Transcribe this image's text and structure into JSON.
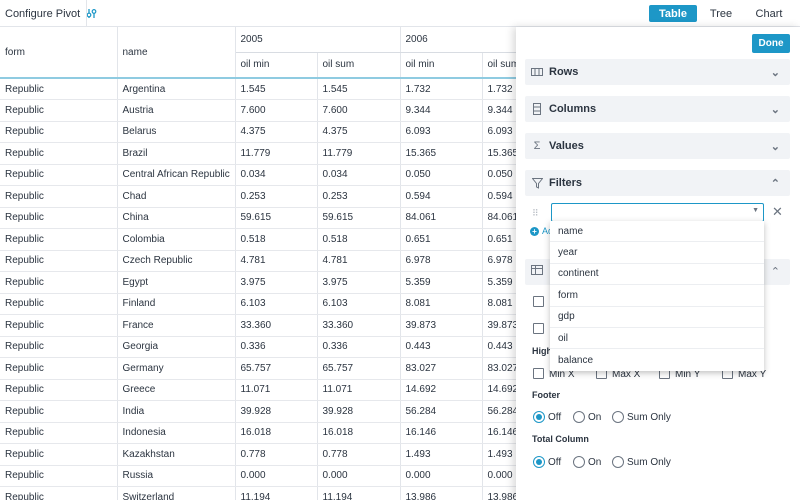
{
  "toolbar": {
    "configure_label": "Configure Pivot",
    "configure_icon": "sliders-icon",
    "views": [
      "Table",
      "Tree",
      "Chart"
    ],
    "active_view": "Table"
  },
  "table": {
    "col_form": "form",
    "col_name": "name",
    "years": [
      "2005",
      "2006"
    ],
    "measures": [
      "oil min",
      "oil sum",
      "oil min",
      "oil sum"
    ],
    "rows": [
      [
        "Republic",
        "Argentina",
        "1.545",
        "1.545",
        "1.732",
        "1.732"
      ],
      [
        "Republic",
        "Austria",
        "7.600",
        "7.600",
        "9.344",
        "9.344"
      ],
      [
        "Republic",
        "Belarus",
        "4.375",
        "4.375",
        "6.093",
        "6.093"
      ],
      [
        "Republic",
        "Brazil",
        "11.779",
        "11.779",
        "15.365",
        "15.365"
      ],
      [
        "Republic",
        "Central African Republic",
        "0.034",
        "0.034",
        "0.050",
        "0.050"
      ],
      [
        "Republic",
        "Chad",
        "0.253",
        "0.253",
        "0.594",
        "0.594"
      ],
      [
        "Republic",
        "China",
        "59.615",
        "59.615",
        "84.061",
        "84.061"
      ],
      [
        "Republic",
        "Colombia",
        "0.518",
        "0.518",
        "0.651",
        "0.651"
      ],
      [
        "Republic",
        "Czech Republic",
        "4.781",
        "4.781",
        "6.978",
        "6.978"
      ],
      [
        "Republic",
        "Egypt",
        "3.975",
        "3.975",
        "5.359",
        "5.359"
      ],
      [
        "Republic",
        "Finland",
        "6.103",
        "6.103",
        "8.081",
        "8.081"
      ],
      [
        "Republic",
        "France",
        "33.360",
        "33.360",
        "39.873",
        "39.873"
      ],
      [
        "Republic",
        "Georgia",
        "0.336",
        "0.336",
        "0.443",
        "0.443"
      ],
      [
        "Republic",
        "Germany",
        "65.757",
        "65.757",
        "83.027",
        "83.027"
      ],
      [
        "Republic",
        "Greece",
        "11.071",
        "11.071",
        "14.692",
        "14.692"
      ],
      [
        "Republic",
        "India",
        "39.928",
        "39.928",
        "56.284",
        "56.284"
      ],
      [
        "Republic",
        "Indonesia",
        "16.018",
        "16.018",
        "16.146",
        "16.146"
      ],
      [
        "Republic",
        "Kazakhstan",
        "0.778",
        "0.778",
        "1.493",
        "1.493"
      ],
      [
        "Republic",
        "Russia",
        "0.000",
        "0.000",
        "0.000",
        "0.000"
      ],
      [
        "Republic",
        "Switzerland",
        "11.194",
        "11.194",
        "13.986",
        "13.986"
      ]
    ]
  },
  "panel": {
    "done_label": "Done",
    "sections": [
      {
        "label": "Rows",
        "icon": "rows-icon"
      },
      {
        "label": "Columns",
        "icon": "columns-icon"
      },
      {
        "label": "Values",
        "icon": "sigma-icon"
      },
      {
        "label": "Filters",
        "icon": "filter-icon"
      }
    ],
    "add_label": "Ad",
    "filter_options": [
      "name",
      "year",
      "continent",
      "form",
      "gdp",
      "oil",
      "balance"
    ],
    "highlight_partial": "Highl",
    "highlight_options": [
      "Min X",
      "Max X",
      "Min Y",
      "Max Y"
    ],
    "footer_label": "Footer",
    "footer_options": [
      "Off",
      "On",
      "Sum Only"
    ],
    "footer_selected": "Off",
    "total_column_label": "Total Column",
    "total_options": [
      "Off",
      "On",
      "Sum Only"
    ],
    "total_selected": "Off"
  }
}
